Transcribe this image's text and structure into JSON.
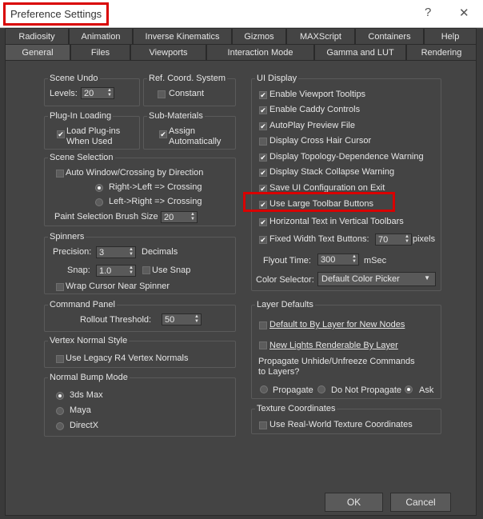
{
  "window": {
    "title": "Preference Settings",
    "help_symbol": "?",
    "close_symbol": "✕"
  },
  "tabs_row1": [
    "Radiosity",
    "Animation",
    "Inverse Kinematics",
    "Gizmos",
    "MAXScript",
    "Containers",
    "Help"
  ],
  "tabs_row2": [
    "General",
    "Files",
    "Viewports",
    "Interaction Mode",
    "Gamma and LUT",
    "Rendering"
  ],
  "scene_undo": {
    "title": "Scene Undo",
    "levels_label": "Levels:",
    "levels_value": "20"
  },
  "ref_coord": {
    "title": "Ref. Coord. System",
    "constant": "Constant"
  },
  "plugin_loading": {
    "title": "Plug-In Loading",
    "load_line1": "Load Plug-ins",
    "load_line2": "When Used"
  },
  "sub_materials": {
    "title": "Sub-Materials",
    "assign_line1": "Assign",
    "assign_line2": "Automatically"
  },
  "scene_selection": {
    "title": "Scene Selection",
    "auto_window": "Auto Window/Crossing by Direction",
    "right_left": "Right->Left => Crossing",
    "left_right": "Left->Right => Crossing",
    "paint_label": "Paint Selection Brush Size",
    "paint_value": "20"
  },
  "spinners": {
    "title": "Spinners",
    "precision_label": "Precision:",
    "precision_value": "3",
    "decimals": "Decimals",
    "snap_label": "Snap:",
    "snap_value": "1.0",
    "use_snap": "Use Snap",
    "wrap_cursor": "Wrap Cursor Near Spinner"
  },
  "command_panel": {
    "title": "Command Panel",
    "rollout_label": "Rollout Threshold:",
    "rollout_value": "50"
  },
  "vertex_normal": {
    "title": "Vertex Normal Style",
    "legacy": "Use Legacy R4 Vertex Normals"
  },
  "normal_bump": {
    "title": "Normal Bump Mode",
    "opt1": "3ds Max",
    "opt2": "Maya",
    "opt3": "DirectX"
  },
  "ui_display": {
    "title": "UI Display",
    "items": [
      "Enable Viewport Tooltips",
      "Enable Caddy Controls",
      "AutoPlay Preview File",
      "Display Cross Hair Cursor",
      "Display Topology-Dependence Warning",
      "Display Stack Collapse Warning",
      "Save UI Configuration on Exit",
      "Use Large Toolbar Buttons",
      "Horizontal Text in Vertical Toolbars",
      "Fixed Width Text Buttons:"
    ],
    "fixed_width_value": "70",
    "pixels": "pixels",
    "flyout_label": "Flyout Time:",
    "flyout_value": "300",
    "msec": "mSec",
    "color_selector_label": "Color Selector:",
    "color_selector_value": "Default Color Picker"
  },
  "layer_defaults": {
    "title": "Layer Defaults",
    "default_bylayer": "Default to By Layer for New Nodes",
    "new_lights": "New Lights Renderable By Layer",
    "propagate_line1": "Propagate Unhide/Unfreeze Commands",
    "propagate_line2": "to Layers?",
    "opt_propagate": "Propagate",
    "opt_dont": "Do Not Propagate",
    "opt_ask": "Ask"
  },
  "texture_coords": {
    "title": "Texture Coordinates",
    "real_world": "Use Real-World Texture Coordinates"
  },
  "buttons": {
    "ok": "OK",
    "cancel": "Cancel"
  },
  "colors": {
    "highlight": "#d90000",
    "background": "#444444"
  }
}
